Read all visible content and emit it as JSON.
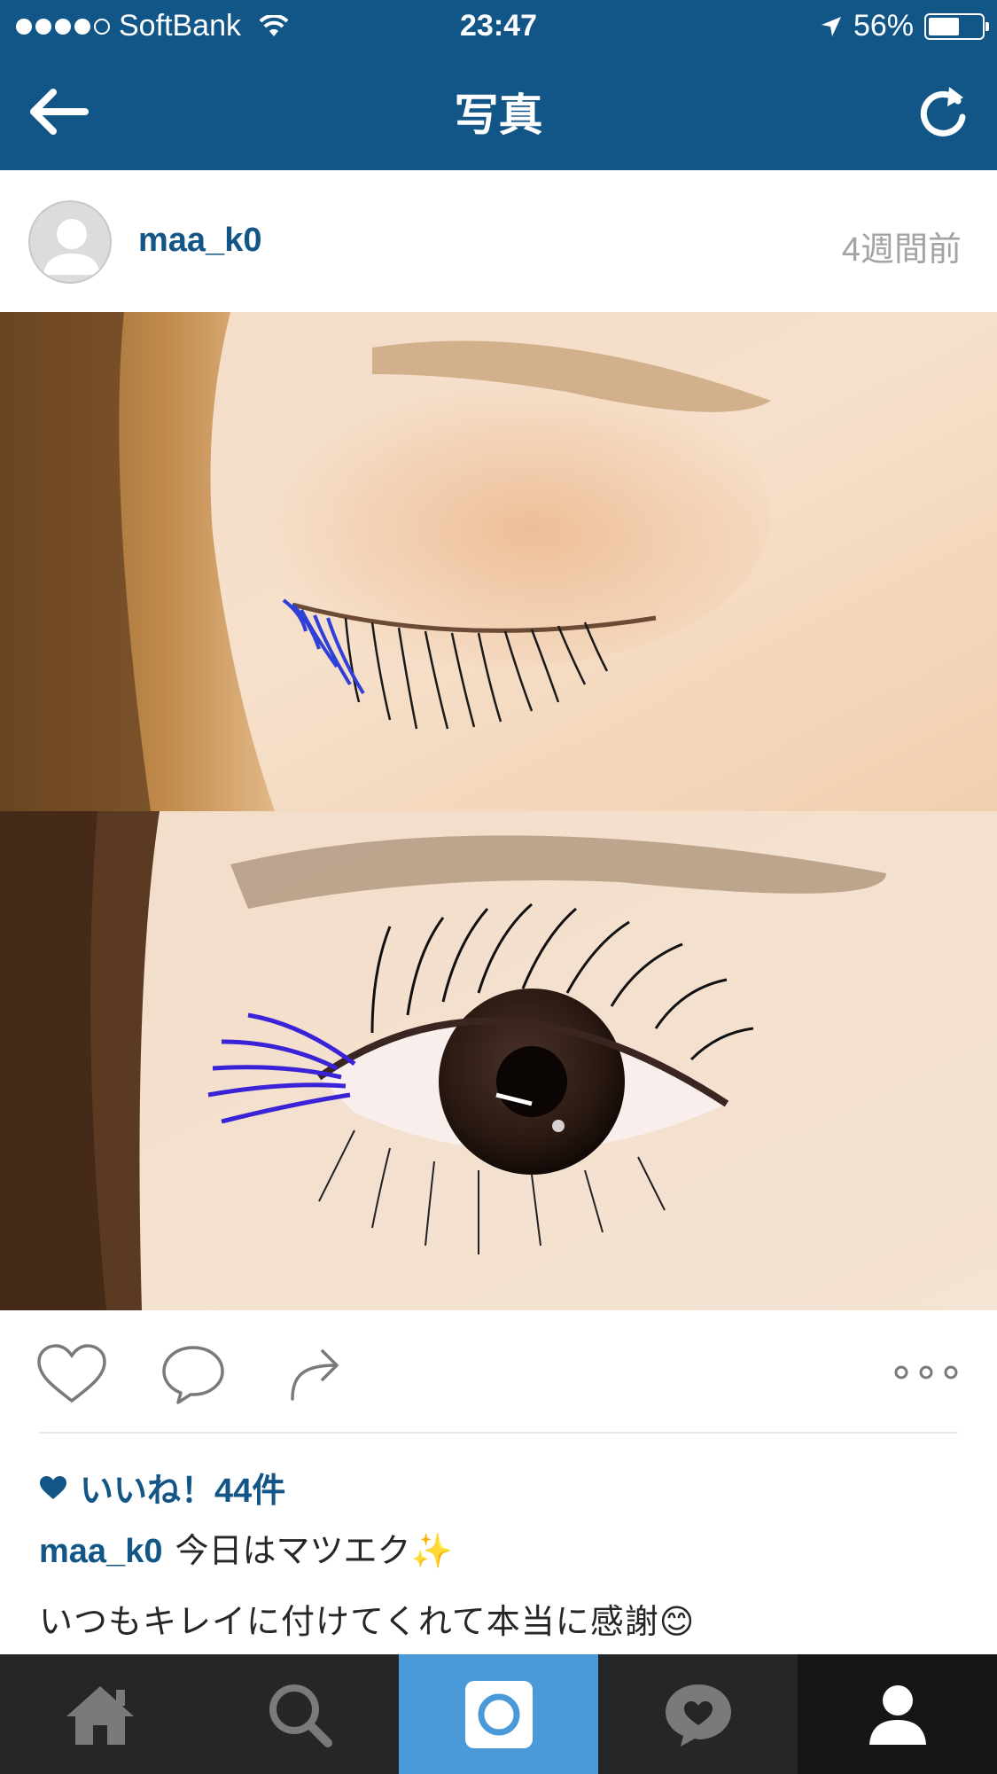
{
  "status_bar": {
    "carrier": "SoftBank",
    "time": "23:47",
    "battery": "56%",
    "battery_level": 0.56,
    "signal_dots_filled": 4,
    "signal_dots_total": 5
  },
  "nav": {
    "title": "写真",
    "back_icon": "back-arrow-icon",
    "refresh_icon": "refresh-icon",
    "color": "#125688"
  },
  "post": {
    "username": "maa_k0",
    "time_ago": "4週間前",
    "photo_top_desc_icon": "closed-eye-photo",
    "photo_bottom_desc_icon": "open-eye-photo"
  },
  "actions": {
    "like_icon": "heart-outline-icon",
    "comment_icon": "comment-bubble-icon",
    "share_icon": "share-arrow-icon",
    "more_icon": "more-dots-icon"
  },
  "likes": {
    "text": "いいね！44件"
  },
  "caption": {
    "username": "maa_k0",
    "line1": "今日はマツエク✨",
    "line2": "いつもキレイに付けてくれて本当に感謝😊"
  },
  "tabbar": {
    "items": [
      {
        "icon": "home-icon",
        "active": false
      },
      {
        "icon": "search-icon",
        "active": false
      },
      {
        "icon": "camera-icon",
        "active": true
      },
      {
        "icon": "activity-heart-bubble-icon",
        "active": false
      },
      {
        "icon": "profile-icon",
        "active": false
      }
    ],
    "active_color": "#4a9ad9"
  }
}
